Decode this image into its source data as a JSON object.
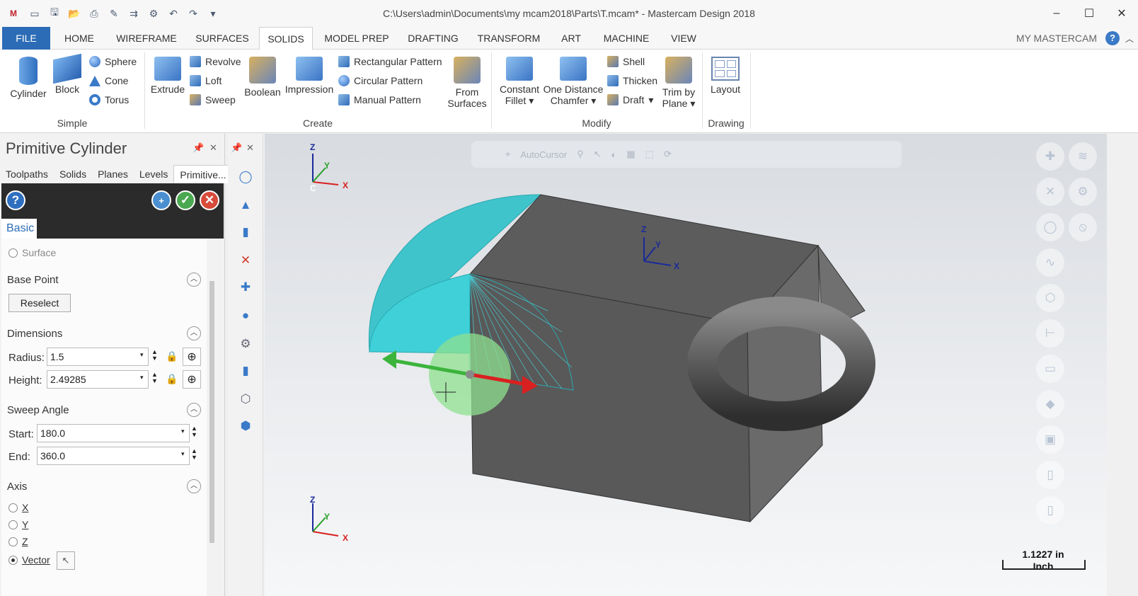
{
  "title_bar": {
    "app_logo": "M",
    "title": "C:\\Users\\admin\\Documents\\my mcam2018\\Parts\\T.mcam* - Mastercam Design 2018"
  },
  "tabs": {
    "file": "FILE",
    "home": "HOME",
    "wireframe": "WIREFRAME",
    "surfaces": "SURFACES",
    "solids": "SOLIDS",
    "model_prep": "MODEL PREP",
    "drafting": "DRAFTING",
    "transform": "TRANSFORM",
    "art": "ART",
    "machine": "MACHINE",
    "view": "VIEW",
    "my_mastercam": "MY MASTERCAM"
  },
  "ribbon": {
    "simple": {
      "label": "Simple",
      "cylinder": "Cylinder",
      "block": "Block",
      "sphere": "Sphere",
      "cone": "Cone",
      "torus": "Torus"
    },
    "create": {
      "label": "Create",
      "extrude": "Extrude",
      "revolve": "Revolve",
      "loft": "Loft",
      "sweep": "Sweep",
      "boolean": "Boolean",
      "impression": "Impression",
      "rect_pattern": "Rectangular Pattern",
      "circ_pattern": "Circular Pattern",
      "manual_pattern": "Manual Pattern",
      "from_surfaces_1": "From",
      "from_surfaces_2": "Surfaces"
    },
    "modify": {
      "label": "Modify",
      "fillet_1": "Constant",
      "fillet_2": "Fillet",
      "chamfer_1": "One Distance",
      "chamfer_2": "Chamfer",
      "shell": "Shell",
      "thicken": "Thicken",
      "draft": "Draft",
      "trim_1": "Trim by",
      "trim_2": "Plane"
    },
    "drawing": {
      "label": "Drawing",
      "layout": "Layout"
    }
  },
  "panel": {
    "title": "Primitive Cylinder",
    "tabs": [
      "Toolpaths",
      "Solids",
      "Planes",
      "Levels",
      "Primitive..."
    ],
    "basic_tab": "Basic",
    "surface_label": "Surface",
    "base_point": "Base Point",
    "reselect": "Reselect",
    "dimensions": "Dimensions",
    "radius_label": "Radius:",
    "radius_value": "1.5",
    "height_label": "Height:",
    "height_value": "2.49285",
    "sweep_angle": "Sweep Angle",
    "start_label": "Start:",
    "start_value": "180.0",
    "end_label": "End:",
    "end_value": "360.0",
    "axis": "Axis",
    "axis_x": "X",
    "axis_y": "Y",
    "axis_z": "Z",
    "axis_vector": "Vector",
    "axis_selected": "Vector"
  },
  "viewport": {
    "autocursor": "AutoCursor",
    "scale_value": "1.1227 in",
    "scale_unit": "Inch",
    "gnomon_top": {
      "z": "Z",
      "y": "Y",
      "x": "X",
      "c": "C"
    },
    "gnomon_bottom": {
      "z": "Z",
      "y": "Y",
      "x": "X"
    },
    "gnomon_model": {
      "z": "Z",
      "y": "Y",
      "x": "X"
    }
  },
  "colors": {
    "file_tab": "#2c6cb6",
    "preview_cyan": "#3fd0d8",
    "arrow_green": "#3cb43c",
    "arrow_red": "#d82020"
  }
}
